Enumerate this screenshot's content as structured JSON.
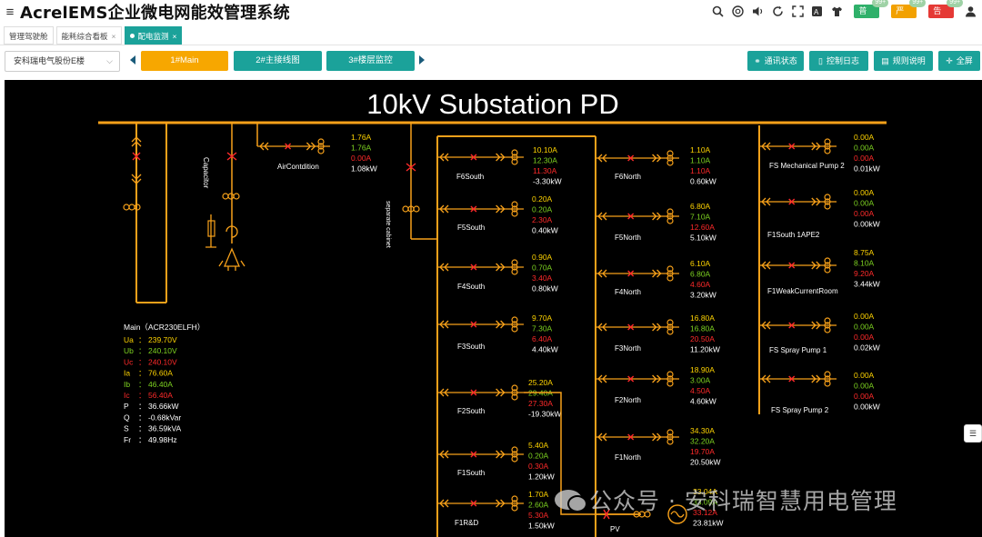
{
  "header": {
    "title": "AcrelEMS企业微电网能效管理系统",
    "alarms": [
      {
        "label": "普通",
        "count": "99+",
        "color": "#2fb06a"
      },
      {
        "label": "严重",
        "count": "99+",
        "color": "#f2a100"
      },
      {
        "label": "告警",
        "count": "99+",
        "color": "#e53935"
      }
    ]
  },
  "tabs": [
    {
      "label": "管理驾驶舱",
      "active": false
    },
    {
      "label": "能耗综合看板",
      "active": false
    },
    {
      "label": "配电监测",
      "active": true
    }
  ],
  "toolbar": {
    "site": "安科瑞电气股份E楼",
    "views": [
      "1#Main",
      "2#主接线图",
      "3#楼层监控"
    ],
    "actions": [
      "通讯状态",
      "控制日志",
      "规则说明",
      "全屏"
    ]
  },
  "diagram": {
    "title": "10kV Substation PD",
    "labels": {
      "capacitor": "Capacitor",
      "aircond": "AirContdition",
      "separate": "separate cabinet",
      "pv": "PV"
    },
    "aircond": [
      "1.76A",
      "1.76A",
      "0.00A",
      "1.08kW"
    ],
    "main": {
      "heading": "Main（ACR230ELFH）",
      "rows": [
        [
          "Ua",
          "：",
          "239.70V"
        ],
        [
          "Ub",
          "：",
          "240.10V"
        ],
        [
          "Uc",
          "：",
          "240.10V"
        ],
        [
          "Ia",
          "：",
          "76.60A"
        ],
        [
          "Ib",
          "：",
          "46.40A"
        ],
        [
          "Ic",
          "：",
          "56.40A"
        ],
        [
          "P",
          "：",
          "36.66kW"
        ],
        [
          "Q",
          "：",
          "-0.68kVar"
        ],
        [
          "S",
          "：",
          "36.59kVA"
        ],
        [
          "Fr",
          "：",
          "49.98Hz"
        ]
      ]
    },
    "feeders": [
      {
        "name": "F6South",
        "values": [
          "10.10A",
          "12.30A",
          "11.30A",
          "-3.30kW"
        ]
      },
      {
        "name": "F5South",
        "values": [
          "0.20A",
          "0.20A",
          "2.30A",
          "0.40kW"
        ]
      },
      {
        "name": "F4South",
        "values": [
          "0.90A",
          "0.70A",
          "3.40A",
          "0.80kW"
        ]
      },
      {
        "name": "F3South",
        "values": [
          "9.70A",
          "7.30A",
          "6.40A",
          "4.40kW"
        ]
      },
      {
        "name": "F2South",
        "values": [
          "25.20A",
          "29.40A",
          "27.30A",
          "-19.30kW"
        ]
      },
      {
        "name": "F1South",
        "values": [
          "5.40A",
          "0.20A",
          "0.30A",
          "1.20kW"
        ]
      },
      {
        "name": "F1R&D",
        "values": [
          "1.70A",
          "2.60A",
          "5.30A",
          "1.50kW"
        ]
      },
      {
        "name": "F6North",
        "values": [
          "1.10A",
          "1.10A",
          "1.10A",
          "0.60kW"
        ]
      },
      {
        "name": "F5North",
        "values": [
          "6.80A",
          "7.10A",
          "12.60A",
          "5.10kW"
        ]
      },
      {
        "name": "F4North",
        "values": [
          "6.10A",
          "6.80A",
          "4.60A",
          "3.20kW"
        ]
      },
      {
        "name": "F3North",
        "values": [
          "16.80A",
          "16.80A",
          "20.50A",
          "11.20kW"
        ]
      },
      {
        "name": "F2North",
        "values": [
          "18.90A",
          "3.00A",
          "4.50A",
          "4.60kW"
        ]
      },
      {
        "name": "F1North",
        "values": [
          "34.30A",
          "32.20A",
          "19.70A",
          "20.50kW"
        ]
      },
      {
        "name": "FS Mechanical Pump 2",
        "values": [
          "0.00A",
          "0.00A",
          "0.00A",
          "0.01kW"
        ]
      },
      {
        "name": "F1South 1APE2",
        "values": [
          "0.00A",
          "0.00A",
          "0.00A",
          "0.00kW"
        ]
      },
      {
        "name": "F1WeakCurrentRoom",
        "values": [
          "8.75A",
          "8.10A",
          "9.20A",
          "3.44kW"
        ]
      },
      {
        "name": "FS Spray Pump 1",
        "values": [
          "0.00A",
          "0.00A",
          "0.00A",
          "0.02kW"
        ]
      },
      {
        "name": "FS Spray Pump 2",
        "values": [
          "0.00A",
          "0.00A",
          "0.00A",
          "0.00kW"
        ]
      }
    ],
    "pv_values": [
      "33.04A",
      "33.09A",
      "33.12A",
      "23.81kW"
    ]
  },
  "watermark": "公众号 · 安科瑞智慧用电管理",
  "colors": {
    "line": "#f7a11a",
    "phaseA": "#ffd400",
    "phaseB": "#7ed321",
    "phaseC": "#ff2a2a",
    "power": "#ffffff",
    "accent": "#1ba29a",
    "active_view": "#f7a700"
  }
}
